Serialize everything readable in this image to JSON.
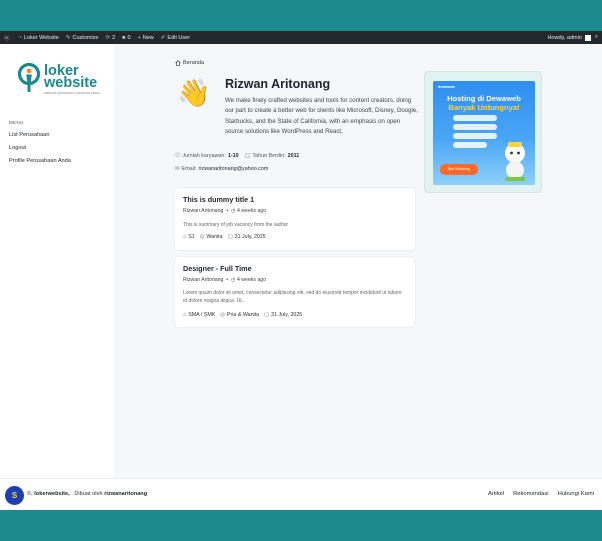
{
  "adminbar": {
    "site_name": "Loker Website",
    "customize": "Customize",
    "updates_count": "2",
    "comments_count": "0",
    "new_label": "New",
    "edit_label": "Edit User",
    "howdy": "Howdy, admin"
  },
  "sidebar": {
    "logo_line1": "loker",
    "logo_line2": "website",
    "logo_tagline": "WEBSITE PENCARIAN LOWONGAN KERJA",
    "menu_heading": "MENU",
    "items": [
      {
        "label": "List Perusahaan"
      },
      {
        "label": "Logout"
      },
      {
        "label": "Profile Perusahaan Anda"
      }
    ]
  },
  "breadcrumb": {
    "home": "Beranda"
  },
  "profile": {
    "emoji": "👋",
    "name": "Rizwan Aritonang",
    "description": "We make finely crafted websites and tools for content creators, doing our part to create a better web for clients like Microsoft, Disney, Google, Starbucks, and the State of California, with an emphasis on open source solutions like WordPress and React.",
    "employees_label": "Jumlah karyawan:",
    "employees_value": "1-10",
    "founded_label": "Tahun Berdiri:",
    "founded_value": "2011",
    "email_label": "Email:",
    "email_value": "rizwanaritonang@yahoo.com"
  },
  "ad": {
    "brand": "dewaweb",
    "headline1": "Hosting di Dewaweb",
    "headline2": "Banyak Untungnya!",
    "cta": "Beli Sekarang"
  },
  "jobs": [
    {
      "title": "This is dummy title 1",
      "author": "Rizwan Aritonang",
      "time": "4 weeks ago",
      "summary": "This is summary of job vacancy from the author",
      "education": "S1",
      "gender": "Wanita",
      "date": "31 July, 2025"
    },
    {
      "title": "Designer - Full Time",
      "author": "Rizwan Aritonang",
      "time": "4 weeks ago",
      "summary": "Lorem ipsum dolor sit amet, consectetur adipiscing elit, sed do eiusmod tempor incididunt ut labore et dolore magna aliqua. Ut...",
      "education": "SMA / SMK",
      "gender": "Pria & Wanita",
      "date": "31 July, 2025"
    }
  ],
  "footer": {
    "prefix": "©,",
    "site": "lokerwebsite,",
    "made_by": ". Dibuat oleh",
    "author": "rizwanaritonang",
    "links": [
      {
        "label": "Artikel"
      },
      {
        "label": "Rekomendasi"
      },
      {
        "label": "Hubungi Kami"
      }
    ]
  },
  "colors": {
    "brand": "#1b8a8c",
    "band": "#1d8a8e",
    "adminbar": "#23282d"
  }
}
